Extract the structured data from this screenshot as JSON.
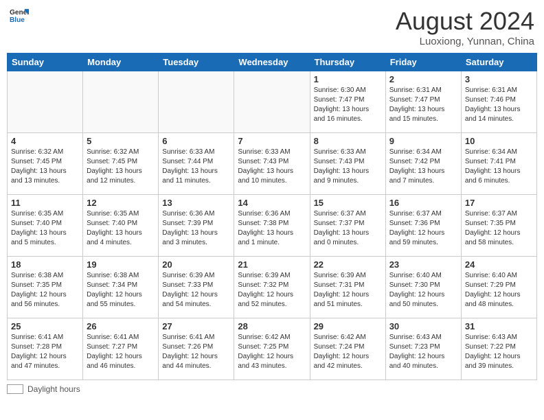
{
  "logo": {
    "line1": "General",
    "line2": "Blue"
  },
  "title": "August 2024",
  "location": "Luoxiong, Yunnan, China",
  "weekdays": [
    "Sunday",
    "Monday",
    "Tuesday",
    "Wednesday",
    "Thursday",
    "Friday",
    "Saturday"
  ],
  "legend": {
    "label": "Daylight hours"
  },
  "weeks": [
    [
      {
        "day": "",
        "info": ""
      },
      {
        "day": "",
        "info": ""
      },
      {
        "day": "",
        "info": ""
      },
      {
        "day": "",
        "info": ""
      },
      {
        "day": "1",
        "info": "Sunrise: 6:30 AM\nSunset: 7:47 PM\nDaylight: 13 hours\nand 16 minutes."
      },
      {
        "day": "2",
        "info": "Sunrise: 6:31 AM\nSunset: 7:47 PM\nDaylight: 13 hours\nand 15 minutes."
      },
      {
        "day": "3",
        "info": "Sunrise: 6:31 AM\nSunset: 7:46 PM\nDaylight: 13 hours\nand 14 minutes."
      }
    ],
    [
      {
        "day": "4",
        "info": "Sunrise: 6:32 AM\nSunset: 7:45 PM\nDaylight: 13 hours\nand 13 minutes."
      },
      {
        "day": "5",
        "info": "Sunrise: 6:32 AM\nSunset: 7:45 PM\nDaylight: 13 hours\nand 12 minutes."
      },
      {
        "day": "6",
        "info": "Sunrise: 6:33 AM\nSunset: 7:44 PM\nDaylight: 13 hours\nand 11 minutes."
      },
      {
        "day": "7",
        "info": "Sunrise: 6:33 AM\nSunset: 7:43 PM\nDaylight: 13 hours\nand 10 minutes."
      },
      {
        "day": "8",
        "info": "Sunrise: 6:33 AM\nSunset: 7:43 PM\nDaylight: 13 hours\nand 9 minutes."
      },
      {
        "day": "9",
        "info": "Sunrise: 6:34 AM\nSunset: 7:42 PM\nDaylight: 13 hours\nand 7 minutes."
      },
      {
        "day": "10",
        "info": "Sunrise: 6:34 AM\nSunset: 7:41 PM\nDaylight: 13 hours\nand 6 minutes."
      }
    ],
    [
      {
        "day": "11",
        "info": "Sunrise: 6:35 AM\nSunset: 7:40 PM\nDaylight: 13 hours\nand 5 minutes."
      },
      {
        "day": "12",
        "info": "Sunrise: 6:35 AM\nSunset: 7:40 PM\nDaylight: 13 hours\nand 4 minutes."
      },
      {
        "day": "13",
        "info": "Sunrise: 6:36 AM\nSunset: 7:39 PM\nDaylight: 13 hours\nand 3 minutes."
      },
      {
        "day": "14",
        "info": "Sunrise: 6:36 AM\nSunset: 7:38 PM\nDaylight: 13 hours\nand 1 minute."
      },
      {
        "day": "15",
        "info": "Sunrise: 6:37 AM\nSunset: 7:37 PM\nDaylight: 13 hours\nand 0 minutes."
      },
      {
        "day": "16",
        "info": "Sunrise: 6:37 AM\nSunset: 7:36 PM\nDaylight: 12 hours\nand 59 minutes."
      },
      {
        "day": "17",
        "info": "Sunrise: 6:37 AM\nSunset: 7:35 PM\nDaylight: 12 hours\nand 58 minutes."
      }
    ],
    [
      {
        "day": "18",
        "info": "Sunrise: 6:38 AM\nSunset: 7:35 PM\nDaylight: 12 hours\nand 56 minutes."
      },
      {
        "day": "19",
        "info": "Sunrise: 6:38 AM\nSunset: 7:34 PM\nDaylight: 12 hours\nand 55 minutes."
      },
      {
        "day": "20",
        "info": "Sunrise: 6:39 AM\nSunset: 7:33 PM\nDaylight: 12 hours\nand 54 minutes."
      },
      {
        "day": "21",
        "info": "Sunrise: 6:39 AM\nSunset: 7:32 PM\nDaylight: 12 hours\nand 52 minutes."
      },
      {
        "day": "22",
        "info": "Sunrise: 6:39 AM\nSunset: 7:31 PM\nDaylight: 12 hours\nand 51 minutes."
      },
      {
        "day": "23",
        "info": "Sunrise: 6:40 AM\nSunset: 7:30 PM\nDaylight: 12 hours\nand 50 minutes."
      },
      {
        "day": "24",
        "info": "Sunrise: 6:40 AM\nSunset: 7:29 PM\nDaylight: 12 hours\nand 48 minutes."
      }
    ],
    [
      {
        "day": "25",
        "info": "Sunrise: 6:41 AM\nSunset: 7:28 PM\nDaylight: 12 hours\nand 47 minutes."
      },
      {
        "day": "26",
        "info": "Sunrise: 6:41 AM\nSunset: 7:27 PM\nDaylight: 12 hours\nand 46 minutes."
      },
      {
        "day": "27",
        "info": "Sunrise: 6:41 AM\nSunset: 7:26 PM\nDaylight: 12 hours\nand 44 minutes."
      },
      {
        "day": "28",
        "info": "Sunrise: 6:42 AM\nSunset: 7:25 PM\nDaylight: 12 hours\nand 43 minutes."
      },
      {
        "day": "29",
        "info": "Sunrise: 6:42 AM\nSunset: 7:24 PM\nDaylight: 12 hours\nand 42 minutes."
      },
      {
        "day": "30",
        "info": "Sunrise: 6:43 AM\nSunset: 7:23 PM\nDaylight: 12 hours\nand 40 minutes."
      },
      {
        "day": "31",
        "info": "Sunrise: 6:43 AM\nSunset: 7:22 PM\nDaylight: 12 hours\nand 39 minutes."
      }
    ]
  ]
}
